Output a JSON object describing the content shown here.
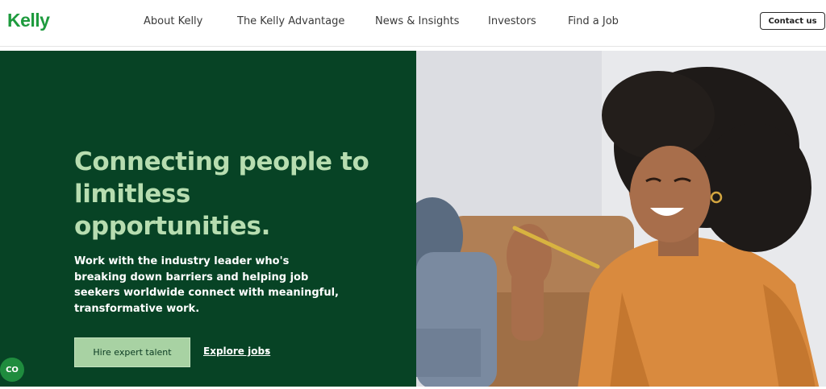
{
  "header": {
    "logo": "Kelly",
    "nav": [
      {
        "label": "About Kelly"
      },
      {
        "label": "The Kelly Advantage"
      },
      {
        "label": "News & Insights"
      },
      {
        "label": "Investors"
      },
      {
        "label": "Find a Job"
      }
    ],
    "contact_label": "Contact us"
  },
  "hero": {
    "title": "Connecting people to limitless opportunities.",
    "description": "Work with the industry leader who's breaking down barriers and helping job seekers worldwide connect with meaningful, transformative work.",
    "hire_label": "Hire expert talent",
    "explore_label": "Explore jobs",
    "photo_icon": "smiling-woman-photo"
  },
  "accessibility": {
    "cc_label": "CO"
  },
  "colors": {
    "brand_green": "#1e9b3e",
    "hero_bg": "#074325",
    "hero_title": "#b7ddb0",
    "hire_button": "#a8d2a3"
  }
}
